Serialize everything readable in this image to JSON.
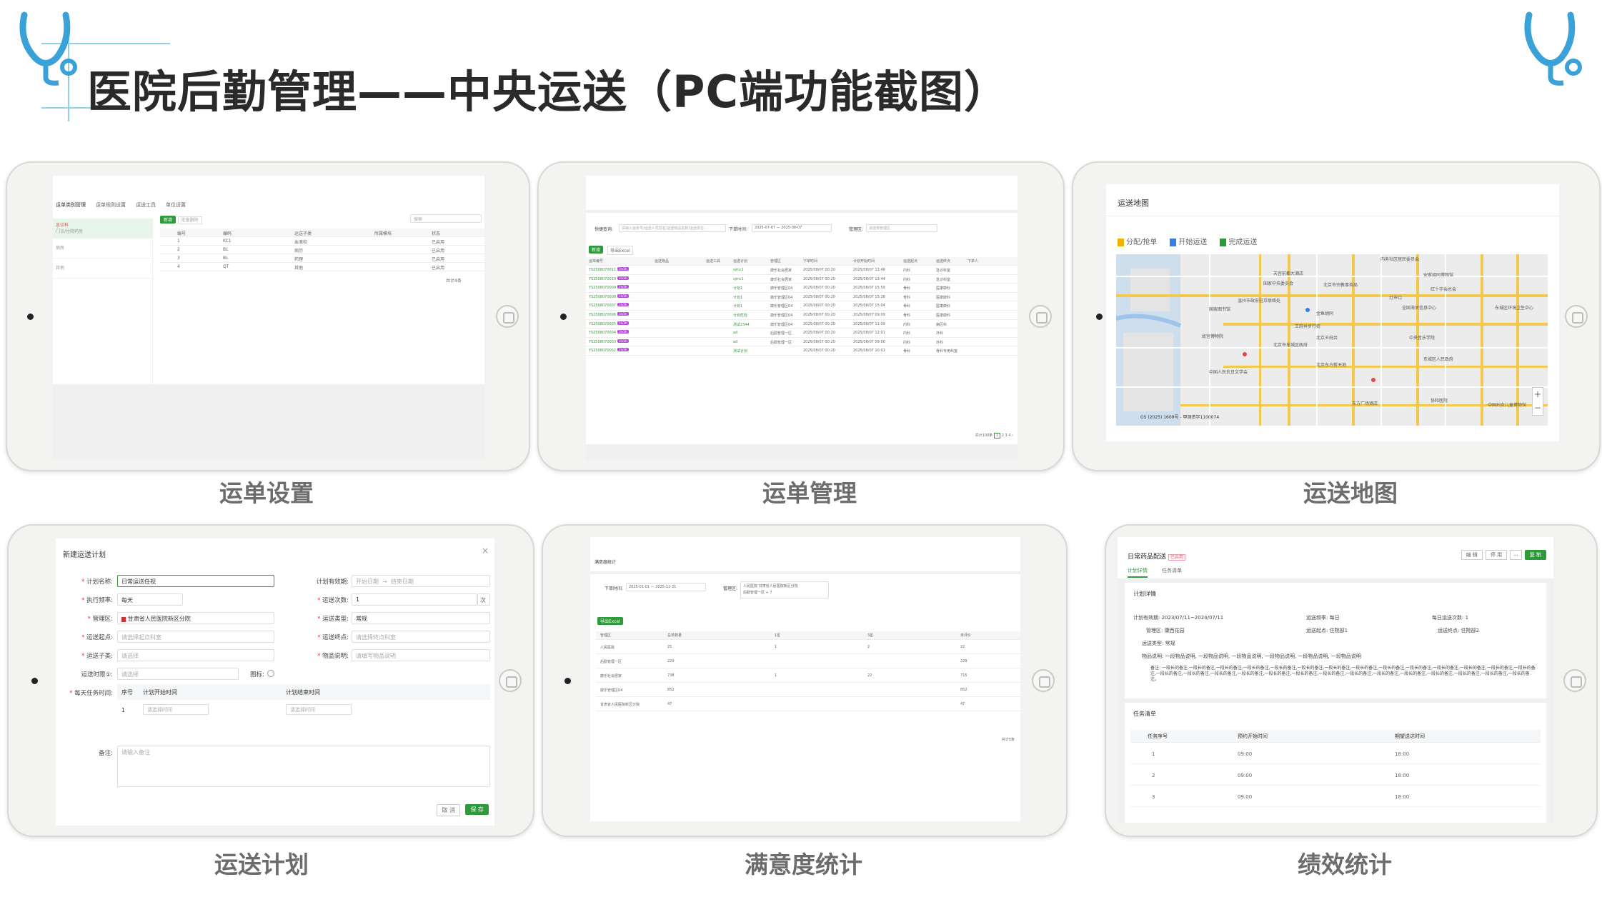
{
  "title": "医院后勤管理——中央运送（PC端功能截图）",
  "icons": {
    "logo": "stethoscope-icon"
  },
  "captions": [
    "运单设置",
    "运单管理",
    "运送地图",
    "运送计划",
    "满意度统计",
    "绩效统计"
  ],
  "s1": {
    "tabs": [
      "运单类别管理",
      "运单规则设置",
      "运送工具",
      "单位设置"
    ],
    "add": "新增",
    "del": "批量删除",
    "search": "搜索",
    "cols": [
      "编号",
      "编码",
      "运送子类",
      "所属模块",
      "状态"
    ],
    "rows": [
      [
        "1",
        "KC1",
        "血液检",
        "已启用"
      ],
      [
        "2",
        "BL",
        "病历",
        "已启用"
      ],
      [
        "3",
        "BL",
        "药理",
        "已启用"
      ],
      [
        "4",
        "QT",
        "其他",
        "已启用"
      ]
    ],
    "side": [
      "急诊科",
      "门诊/住院药房",
      "病房",
      "其他"
    ],
    "total": "共计4条"
  },
  "s2": {
    "label1": "快捷查询:",
    "ph1": "请输入运单号/运送人员姓名/运送物品名称/运送单位...",
    "label2": "下单时间:",
    "d1": "2025-07-07",
    "d2": "2025-08-07",
    "label3": "管理区:",
    "ph3": "请选择管理区",
    "add": "新增",
    "export": "导出Excel",
    "cols": [
      "运单编号",
      "运送物品",
      "运送工具",
      "运送计划",
      "管理区",
      "下单时间",
      "计划开始时间",
      "运送起点",
      "运送终点",
      "下单人"
    ],
    "rows": [
      [
        "YS2508070011",
        "Tag",
        "sjmc1",
        "康乐社会居家",
        "2025/08/07 00:20",
        "2025/08/07 13:49",
        "内科",
        "急诊科室"
      ],
      [
        "YS2508070010",
        "Tag",
        "sjmc1",
        "康乐社会居家",
        "2025/08/07 00:20",
        "2025/08/07 13:44",
        "内科",
        "急诊科室"
      ],
      [
        "YS2508070009",
        "Tag",
        "计划1",
        "康乐管理区04",
        "2025/08/07 00:20",
        "2025/08/07 15:59",
        "骨科",
        "医康康科"
      ],
      [
        "YS2508070008",
        "Tag",
        "计划1",
        "康乐管理区04",
        "2025/08/07 00:20",
        "2025/08/07 15:28",
        "骨科",
        "医康康科"
      ],
      [
        "YS2508070007",
        "Tag",
        "计划1",
        "康乐管理区04",
        "2025/08/07 00:20",
        "2025/08/07 15:04",
        "骨科",
        "医康康科"
      ],
      [
        "YS2508070006",
        "Tag",
        "计划危险",
        "康乐管理区04",
        "2025/08/07 00:20",
        "2025/08/07 09:09",
        "骨科",
        "医康康科"
      ],
      [
        "YS2508070005",
        "Tag",
        "测试2344",
        "康乐管理区04",
        "2025/08/07 00:20",
        "2025/08/07 11:09",
        "内科",
        "病区科"
      ],
      [
        "YS2508070004",
        "Tag",
        "ad",
        "后勤管理一区",
        "2025/08/07 00:20",
        "2025/08/07 12:01",
        "内科",
        "外科"
      ],
      [
        "YS2508070003",
        "Tag",
        "ad",
        "后勤管理一区",
        "2025/08/07 00:20",
        "2025/08/07 09:00",
        "内科",
        "外科"
      ],
      [
        "YS2508070002",
        "Tag",
        "测试计划",
        "",
        "2025/08/07 00:20",
        "2025/08/07 10:01",
        "骨科",
        "骨科专用科室"
      ]
    ],
    "tag": "1h/3h",
    "total": "共计100条"
  },
  "s3": {
    "title": "运送地图",
    "legend": [
      "分配/抢单",
      "开始运送",
      "完成运送"
    ],
    "legend_colors": [
      "#f0b400",
      "#3a7fe0",
      "#2a9a3a"
    ],
    "places": [
      "内务社区居民委员会",
      "天宫前都大酒店",
      "北京市宗教事务局",
      "安家胡同博物馆",
      "红十字会总会",
      "国家图书馆",
      "国家中央委员会",
      "灯市口",
      "全国海关信息中心",
      "东城区环境卫生中心",
      "温州市政府驻京联络处",
      "金鱼胡同",
      "王府井步行街",
      "北京王府井",
      "中央音乐学院",
      "北京市东城区政府",
      "东城区人民政府",
      "故宫博物院",
      "中国人民抗日文学会",
      "北京东方新天地",
      "东方广场酒店",
      "协和医院",
      "中国妇女儿童博物馆"
    ],
    "copyright": "GS (2025) 1609号 - 甲测资字1100074",
    "plus": "+",
    "minus": "−"
  },
  "s4": {
    "title": "新建运送计划",
    "close": "×",
    "f_name": "计划名称:",
    "v_name": "日常运送任视",
    "f_valid": "计划有效期:",
    "ph_start": "开始日期",
    "ph_end": "结束日期",
    "f_freq": "执行频率:",
    "v_freq": "每天",
    "f_times": "运送次数:",
    "v_times": "1",
    "unit": "次",
    "f_area": "管理区:",
    "v_area": "甘肃省人民医院新区分院",
    "f_type": "运送类型:",
    "v_type": "常规",
    "f_from": "运送起点:",
    "ph_from": "请选择起点科室",
    "f_to": "运送终点:",
    "ph_to": "请选择终点科室",
    "f_sub": "运送子类:",
    "ph_sub": "请选择",
    "f_goods": "物品说明:",
    "ph_goods": "请填写物品说明",
    "f_limit": "运送时限①:",
    "ph_limit": "请选择",
    "f_icon": "图标:",
    "f_daily": "每天任务时间:",
    "cols": [
      "序号",
      "计划开始时间",
      "计划结束时间"
    ],
    "row_idx": "1",
    "ph_time": "请选择时间",
    "f_note": "备注:",
    "ph_note": "请输入备注",
    "cancel": "取 消",
    "save": "保 存"
  },
  "s5": {
    "title": "满意度统计",
    "label_date": "下单时间:",
    "d1": "2025-01-01",
    "d2": "2025-12-31",
    "label_area": "管理区:",
    "tag1": "人民医院 甘肃省人民医院新区分院",
    "tag2": "后勤管理一区",
    "more": "+ 7",
    "export": "导出Excel",
    "cols": [
      "管理区",
      "总单数量",
      "1星",
      "3星",
      "未评价"
    ],
    "rows": [
      [
        "人民医院",
        "25",
        "1",
        "2",
        "22"
      ],
      [
        "后勤管理一区",
        "229",
        "",
        "",
        "229"
      ],
      [
        "康乐社会居家",
        "738",
        "1",
        "22",
        "715"
      ],
      [
        "康乐管理区04",
        "852",
        "",
        "",
        "852"
      ],
      [
        "甘肃省人民医院新区分院",
        "47",
        "",
        "",
        "47"
      ]
    ],
    "total": "共计5条"
  },
  "s6": {
    "title": "日常药品配送",
    "status": "已启用",
    "edit": "编 辑",
    "stop": "停 用",
    "dots": "...",
    "copy": "复 制",
    "tabs": [
      "计划详情",
      "任务清单"
    ],
    "sec1": "计划详情",
    "k_valid": "计划有效期:",
    "v_valid": "2023/07/11~2024/07/11",
    "k_freq": "运送频率:",
    "v_freq": "每日",
    "k_times": "每日运送次数:",
    "v_times": "1",
    "k_area": "管理区:",
    "v_area": "康西花园",
    "k_from": "运送起点:",
    "v_from": "住院部1",
    "k_to": "运送终点:",
    "v_to": "住院部2",
    "k_type": "运送类型:",
    "v_type": "常规",
    "k_goods": "物品说明:",
    "v_goods": "一段物品说明, 一段物品说明, 一段物品说明, 一段物品说明, 一段物品说明, 一段物品说明",
    "k_note": "备注:",
    "v_note": "一段长的备注,一段长的备注,一段长的备注,一段长的备注,一段长的备注,一段长的备注,一段长的备注,一段长的备注,一段长的备注,一段长的备注,一段长的备注,一段长的备注,一段长的备注,一段长的备注,一段长的备注,一段长的备注,一段长的备注,一段长的备注,一段长的备注,一段长的备注,一段长的备注,一段长的备注,一段长的备注,一段长的备注,一段长的备注,一段长的备注,一段长的备注,一段长的备注。",
    "sec2": "任务清单",
    "cols": [
      "任务序号",
      "预约开始时间",
      "期望送达时间"
    ],
    "rows": [
      [
        "1",
        "09:00",
        "18:00"
      ],
      [
        "2",
        "09:00",
        "18:00"
      ],
      [
        "3",
        "09:00",
        "18:00"
      ]
    ]
  }
}
